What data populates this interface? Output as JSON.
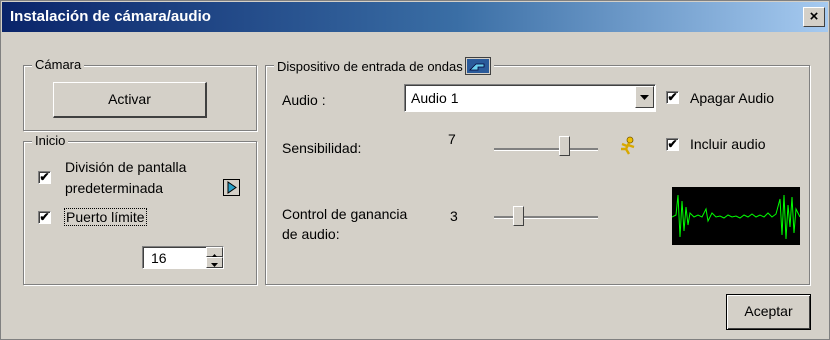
{
  "window": {
    "title": "Instalación de cámara/audio",
    "close_glyph": "×"
  },
  "camera_group": {
    "legend": "Cámara",
    "activate_label": "Activar"
  },
  "start_group": {
    "legend": "Inicio",
    "split_screen_label_line1": "División de pantalla",
    "split_screen_label_line2": "predeterminada",
    "split_screen_checked": true,
    "port_limit_label": "Puerto límite",
    "port_limit_checked": true,
    "port_value": "16"
  },
  "wave_group": {
    "legend": "Dispositivo de entrada de ondas",
    "audio_label": "Audio :",
    "audio_selected": "Audio 1",
    "mute_label": "Apagar Audio",
    "mute_checked": true,
    "sensitivity_label": "Sensibilidad:",
    "sensitivity_value": "7",
    "sensitivity_level": 0.7,
    "include_audio_label": "Incluir audio",
    "include_audio_checked": true,
    "gain_label_line1": "Control de ganancia",
    "gain_label_line2": "de audio:",
    "gain_value": "3",
    "gain_level": 0.2
  },
  "footer": {
    "accept_label": "Aceptar"
  },
  "icons": {
    "hand": "pointing-hand-icon",
    "runner": "running-figure-icon",
    "arrow": "play-arrow-icon"
  },
  "colors": {
    "title_start": "#0a246a",
    "title_end": "#a6caf0",
    "wave": "#00ff00"
  }
}
